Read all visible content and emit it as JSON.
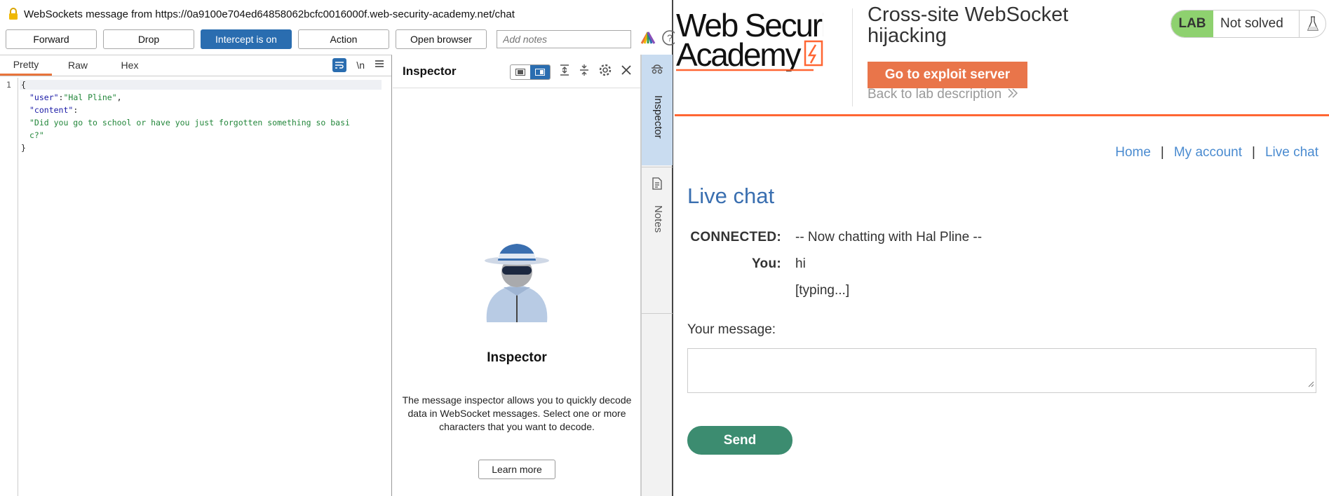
{
  "burp": {
    "window_title": "WebSockets message from https://0a9100e704ed64858062bcfc0016000f.web-security-academy.net/chat",
    "toolbar": {
      "forward": "Forward",
      "drop": "Drop",
      "intercept": "Intercept is on",
      "action": "Action",
      "open_browser": "Open browser",
      "notes_placeholder": "Add notes"
    },
    "editor": {
      "tabs": [
        "Pretty",
        "Raw",
        "Hex"
      ],
      "active_tab": "Pretty",
      "newline_toggle": "\\n",
      "line_number": "1",
      "lines": {
        "open": "{",
        "user_key": "\"user\"",
        "user_val": "\"Hal Pline\"",
        "content_key": "\"content\"",
        "content_val_1": "\"Did you go to school or have you just forgotten something so basi",
        "content_val_2": "c?\"",
        "close": "}"
      }
    },
    "inspector": {
      "header": "Inspector",
      "title": "Inspector",
      "description": "The message inspector allows you to quickly decode data in WebSocket messages. Select one or more characters that you want to decode.",
      "learn_more": "Learn more"
    },
    "rail": {
      "inspector": "Inspector",
      "notes": "Notes"
    }
  },
  "lab": {
    "logo_text": "Web Security Academy",
    "title": "Cross-site WebSocket hijacking",
    "exploit_button": "Go to exploit server",
    "back_link": "Back to lab description",
    "badge": "LAB",
    "status": "Not solved",
    "nav": [
      "Home",
      "My account",
      "Live chat"
    ],
    "nav_sep": "|",
    "page_title": "Live chat",
    "chat": [
      {
        "label": "CONNECTED:",
        "text": "-- Now chatting with Hal Pline --"
      },
      {
        "label": "You:",
        "text": "hi"
      },
      {
        "label": "",
        "text": "[typing...]"
      }
    ],
    "message_label": "Your message:",
    "message_value": "",
    "send": "Send"
  },
  "colors": {
    "burp_accent": "#2a6db0",
    "tab_underline": "#e8743b",
    "academy_orange": "#ff6633",
    "exploit_button": "#e9754a",
    "send_button": "#3c8c70",
    "link_blue": "#4a8bd0",
    "lab_badge": "#8ed16f"
  }
}
